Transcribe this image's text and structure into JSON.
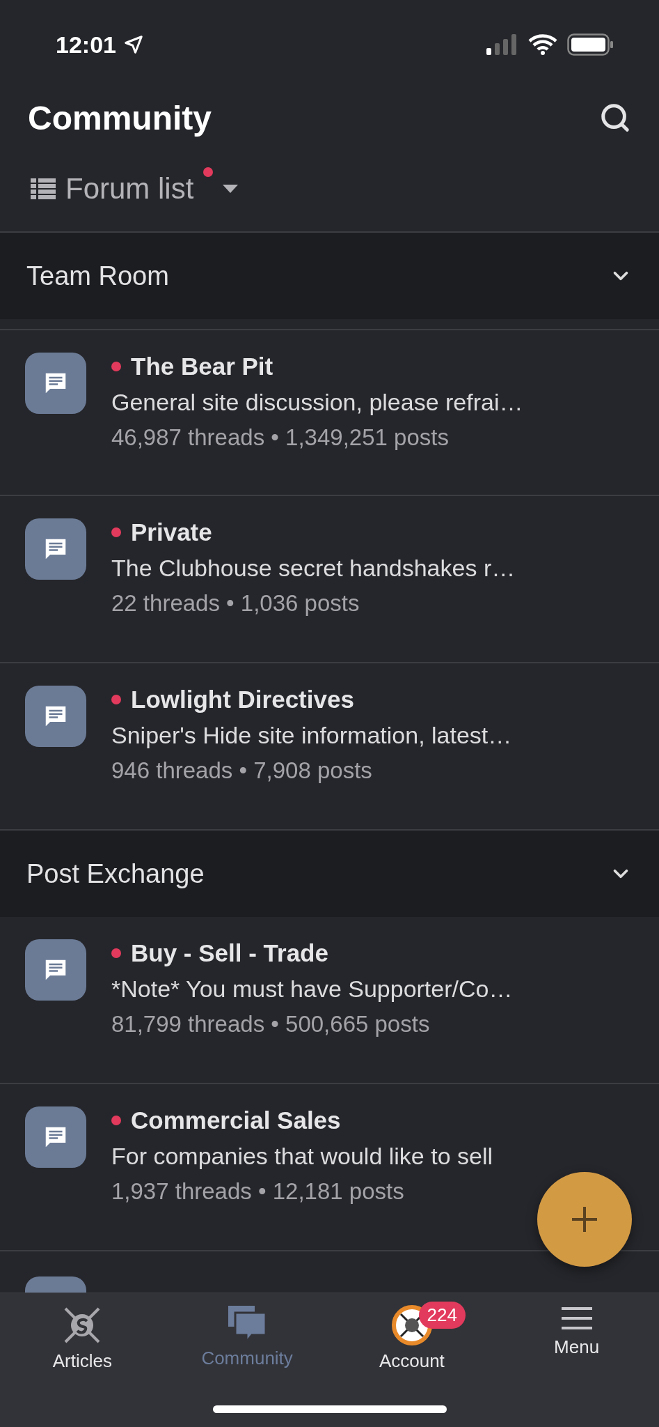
{
  "status_bar": {
    "time": "12:01"
  },
  "header": {
    "title": "Community"
  },
  "view_switcher": {
    "label": "Forum list",
    "unread": true
  },
  "sections": [
    {
      "title": "Team Room",
      "expanded": true,
      "forums": [
        {
          "title": "The Bear Pit",
          "unread": true,
          "description": "General site discussion, please refrai…",
          "stats": "46,987 threads • 1,349,251 posts"
        },
        {
          "title": "Private",
          "unread": true,
          "description": "The Clubhouse secret handshakes r…",
          "stats": "22 threads • 1,036 posts"
        },
        {
          "title": "Lowlight Directives",
          "unread": true,
          "description": "Sniper's Hide site information, latest…",
          "stats": "946 threads • 7,908 posts"
        }
      ]
    },
    {
      "title": "Post Exchange",
      "expanded": true,
      "forums": [
        {
          "title": "Buy - Sell - Trade",
          "unread": true,
          "description": "*Note* You must have Supporter/Co…",
          "stats": "81,799 threads • 500,665 posts"
        },
        {
          "title": "Commercial Sales",
          "unread": true,
          "description": "For companies that would like to sell",
          "stats": "1,937 threads • 12,181 posts"
        }
      ]
    }
  ],
  "tab_bar": [
    {
      "kind": "logo",
      "label": "Articles",
      "selected": false
    },
    {
      "kind": "chat",
      "label": "Community",
      "selected": true
    },
    {
      "kind": "avatar",
      "label": "Account",
      "selected": false,
      "badge": "224"
    },
    {
      "kind": "menu",
      "label": "Menu",
      "selected": false
    }
  ]
}
